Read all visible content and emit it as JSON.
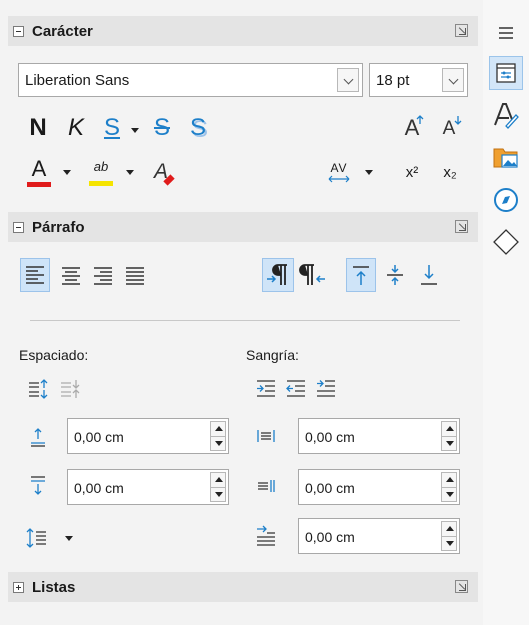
{
  "caracter": {
    "title": "Carácter",
    "font_name": "Liberation Sans",
    "font_size": "18 pt",
    "bold_glyph": "N",
    "italic_glyph": "K",
    "underline_glyph": "S",
    "strike_glyph": "S",
    "shadow_glyph": "S",
    "grow_glyph": "A",
    "shrink_glyph": "A",
    "font_color_glyph": "A",
    "clear_glyph": "A",
    "spacing_glyph": "AV",
    "superscript_glyph": "x²",
    "subscript_glyph": "x₂",
    "highlight_glyph": "ab",
    "colors": {
      "font_color": "#e01b1b",
      "highlight": "#f5e400"
    }
  },
  "parrafo": {
    "title": "Párrafo",
    "espaciado_label": "Espaciado:",
    "sangria_label": "Sangría:",
    "above_spacing": "0,00 cm",
    "below_spacing": "0,00 cm",
    "indent_before": "0,00 cm",
    "indent_after": "0,00 cm",
    "first_line_indent": "0,00 cm"
  },
  "listas": {
    "title": "Listas"
  },
  "colors": {
    "accent": "#1d7fc9",
    "selected_bg": "#cfe4f8"
  }
}
